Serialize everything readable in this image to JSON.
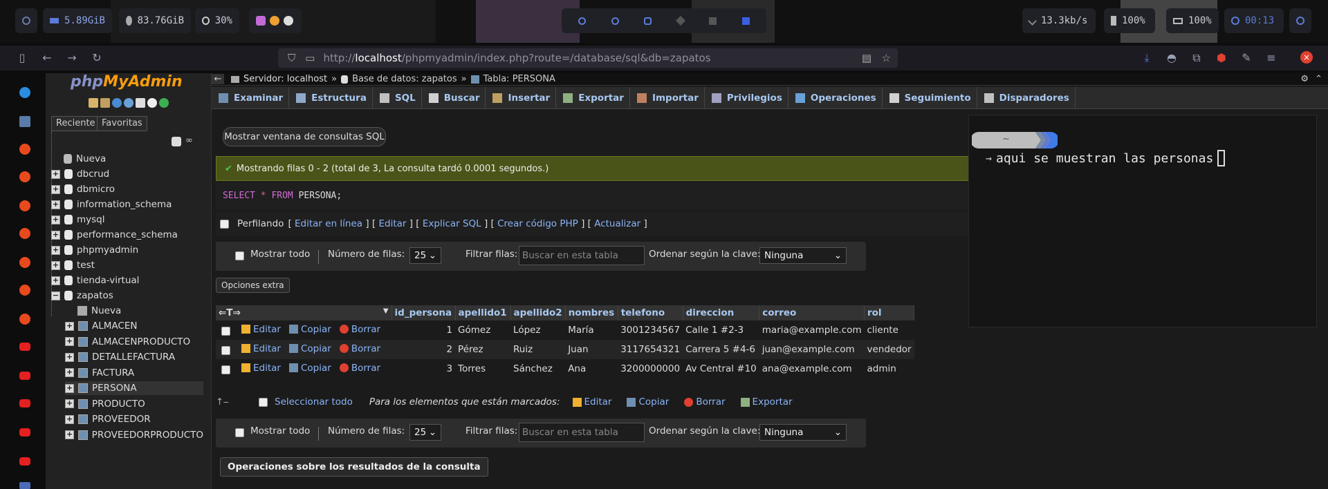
{
  "topbar": {
    "mem": "5.89GiB",
    "disk": "83.76GiB",
    "brightness": "30%",
    "net": "13.3kb/s",
    "volume": "100%",
    "battery": "100%",
    "clock": "00:13"
  },
  "browser": {
    "url_prefix": "http://",
    "url_host": "localhost",
    "url_path": "/phpmyadmin/index.php?route=/database/sql&db=zapatos"
  },
  "pma": {
    "logo_php": "php",
    "logo_myadmin": "MyAdmin",
    "tab_recent": "Reciente",
    "tab_favorites": "Favoritas",
    "new_label": "Nueva",
    "databases": [
      "dbcrud",
      "dbmicro",
      "information_schema",
      "mysql",
      "performance_schema",
      "phpmyadmin",
      "test",
      "tienda-virtual",
      "zapatos"
    ],
    "tables_new": "Nueva",
    "tables": [
      "ALMACEN",
      "ALMACENPRODUCTO",
      "DETALLEFACTURA",
      "FACTURA",
      "PERSONA",
      "PRODUCTO",
      "PROVEEDOR",
      "PROVEEDORPRODUCTO"
    ]
  },
  "breadcrumb": {
    "server": "Servidor: localhost",
    "db": "Base de datos: zapatos",
    "table": "Tabla: PERSONA",
    "sep": "»"
  },
  "tabs": [
    "Examinar",
    "Estructura",
    "SQL",
    "Buscar",
    "Insertar",
    "Exportar",
    "Importar",
    "Privilegios",
    "Operaciones",
    "Seguimiento",
    "Disparadores"
  ],
  "query_window_btn": "Mostrar ventana de consultas SQL",
  "success_msg": "Mostrando filas 0 - 2 (total de 3, La consulta tardó 0.0001 segundos.)",
  "sql": {
    "select": "SELECT",
    "star": "*",
    "from": "FROM",
    "rest": "PERSONA;"
  },
  "profiling": {
    "label": "Perfilando",
    "links": [
      "Editar en línea",
      "Editar",
      "Explicar SQL",
      "Crear código PHP",
      "Actualizar"
    ]
  },
  "nav": {
    "show_all": "Mostrar todo",
    "rows_label": "Número de filas:",
    "rows_value": "25",
    "filter_label": "Filtrar filas:",
    "filter_placeholder": "Buscar en esta tabla",
    "sort_label": "Ordenar según la clave:",
    "sort_value": "Ninguna"
  },
  "extra_options": "Opciones extra",
  "grid": {
    "columns": [
      "id_persona",
      "apellido1",
      "apellido2",
      "nombres",
      "telefono",
      "direccion",
      "correo",
      "rol"
    ],
    "actions": {
      "edit": "Editar",
      "copy": "Copiar",
      "delete": "Borrar"
    },
    "rows": [
      [
        "1",
        "Gómez",
        "López",
        "María",
        "3001234567",
        "Calle 1 #2-3",
        "maria@example.com",
        "cliente"
      ],
      [
        "2",
        "Pérez",
        "Ruiz",
        "Juan",
        "3117654321",
        "Carrera 5 #4-6",
        "juan@example.com",
        "vendedor"
      ],
      [
        "3",
        "Torres",
        "Sánchez",
        "Ana",
        "3200000000",
        "Av Central #10",
        "ana@example.com",
        "admin"
      ]
    ]
  },
  "mass": {
    "select_all": "Seleccionar todo",
    "marked_label": "Para los elementos que están marcados:",
    "edit": "Editar",
    "copy": "Copiar",
    "delete": "Borrar",
    "export": "Exportar"
  },
  "result_ops": "Operaciones sobre los resultados de la consulta",
  "terminal": {
    "tilde": "~",
    "arrow": "→",
    "text": "aqui se muestran las personas"
  },
  "colors": {
    "accent_link": "#8ab4f8",
    "success_bg": "#4b5418",
    "delete_red": "#e04030"
  }
}
